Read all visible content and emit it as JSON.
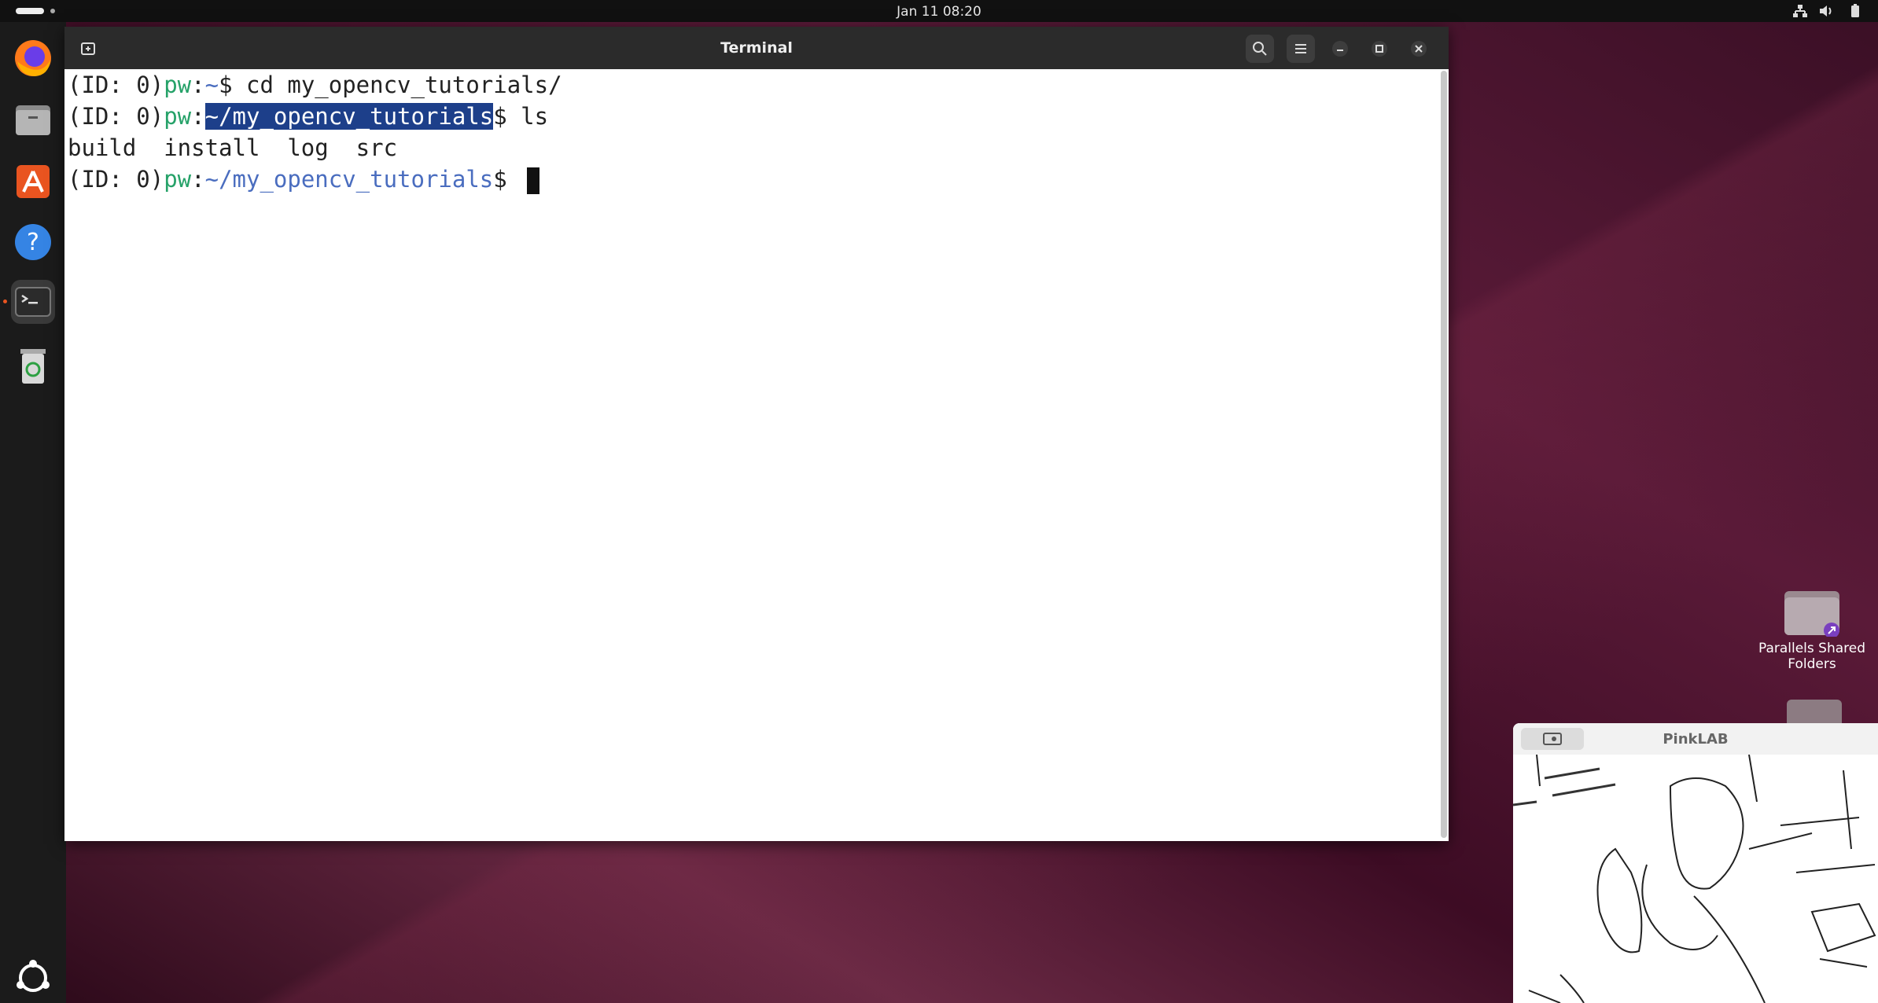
{
  "topbar": {
    "clock": "Jan 11  08:20"
  },
  "terminal": {
    "title": "Terminal",
    "lines": [
      {
        "id": "(ID: 0)",
        "user": "pw",
        "sep": ":",
        "path": "~",
        "cmd": "$ cd my_opencv_tutorials/"
      },
      {
        "id": "(ID: 0)",
        "user": "pw",
        "sep": ":",
        "path": "~/my_opencv_tutorials",
        "cmd": "$ ls"
      },
      {
        "output": "build  install  log  src"
      },
      {
        "id": "(ID: 0)",
        "user": "pw",
        "sep": ":",
        "path": "~/my_opencv_tutorials",
        "cmd": "$ "
      }
    ]
  },
  "desktop": {
    "shared_folder_label": "Parallels Shared Folders"
  },
  "webcam": {
    "title": "PinkLAB"
  },
  "icons": {
    "dock": [
      "firefox-icon",
      "files-icon",
      "app-center-icon",
      "help-icon",
      "terminal-icon",
      "trash-icon",
      "show-apps-icon"
    ],
    "titlebar": [
      "new-tab-icon",
      "search-icon",
      "menu-icon",
      "minimize-icon",
      "maximize-icon",
      "close-icon"
    ]
  },
  "colors": {
    "selection": "#1d3f8a",
    "prompt_user": "#26a269",
    "prompt_path": "#4a6dbf"
  }
}
